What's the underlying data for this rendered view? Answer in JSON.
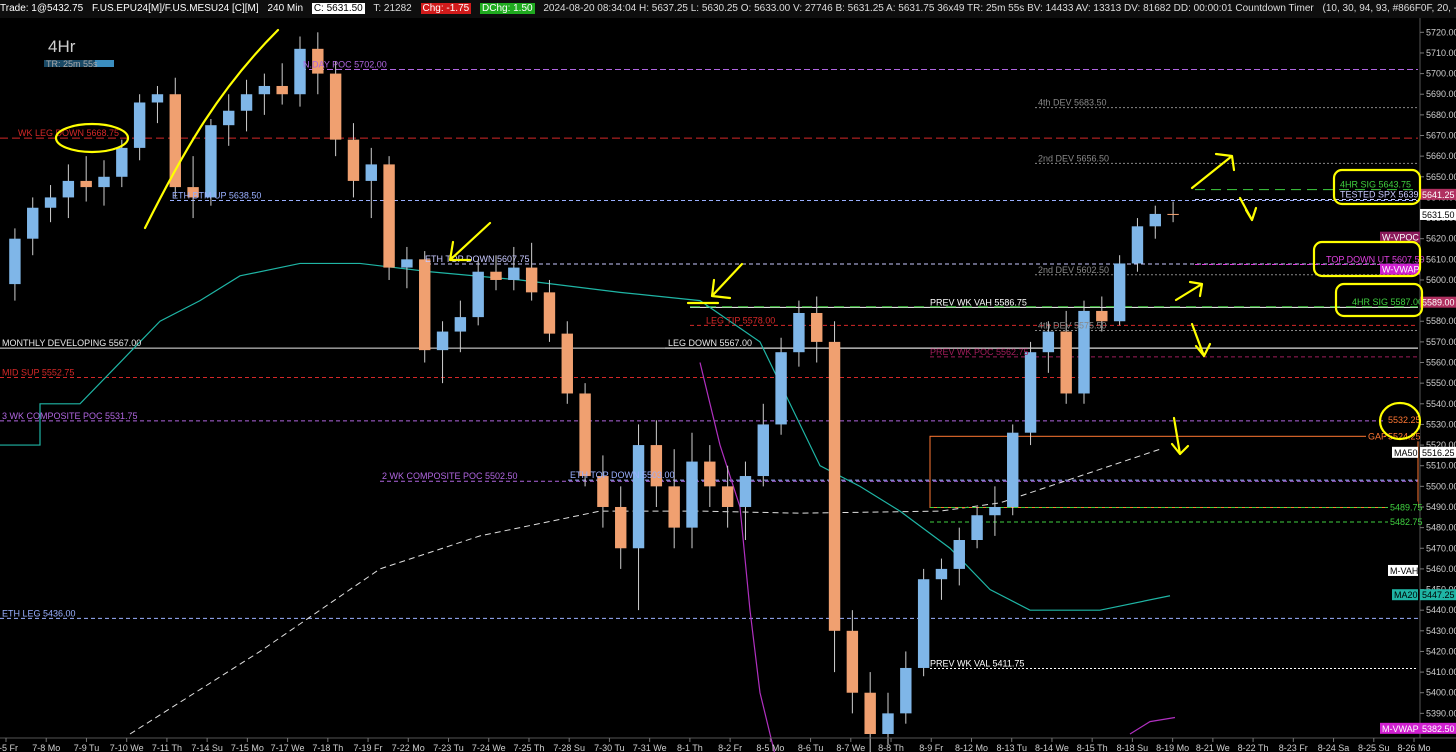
{
  "header": {
    "trade": "Trade: 1@5432.75",
    "symbol": "F.US.EPU24[M]/F.US.MESU24 [C][M]",
    "interval": "240 Min",
    "last": "C: 5631.50",
    "trades": "T: 21282",
    "chg": "Chg: -1.75",
    "dchg": "DChg: 1.50",
    "info": "2024-08-20 08:34:04 H: 5637.25 L: 5630.25 O: 5633.00 V: 27746 B: 5631.25 A: 5631.75 36x49 TR: 25m 55s BV: 14433 AV: 13313 DV: 81682 DD: 00:00:01 Countdown Timer",
    "params": "(10, 30, 94, 93, #866F0F, 20, -0.2, 1)"
  },
  "chart_title": "4Hr",
  "timer_label": "TR: 25m 55s",
  "chart_data": {
    "type": "candlestick",
    "y_range": [
      5380,
      5725
    ],
    "y_ticks": [
      5720,
      5710,
      5700,
      5690,
      5680,
      5670,
      5660,
      5650,
      5640,
      5630,
      5620,
      5610,
      5600,
      5590,
      5580,
      5570,
      5560,
      5550,
      5540,
      5530,
      5520,
      5510,
      5500,
      5490,
      5480,
      5470,
      5460,
      5450,
      5440,
      5430,
      5420,
      5410,
      5400,
      5390
    ],
    "x_labels": [
      "7-5 Fr",
      "7-8 Mo",
      "7-9 Tu",
      "7-10 We",
      "7-11 Th",
      "7-14 Su",
      "7-15 Mo",
      "7-17 We",
      "7-18 Th",
      "7-19 Fr",
      "7-22 Mo",
      "7-23 Tu",
      "7-24 We",
      "7-25 Th",
      "7-28 Su",
      "7-30 Tu",
      "7-31 We",
      "8-1 Th",
      "8-2 Fr",
      "8-5 Mo",
      "8-6 Tu",
      "8-7 We",
      "8-8 Th",
      "8-9 Fr",
      "8-12 Mo",
      "8-13 Tu",
      "8-14 We",
      "8-15 Th",
      "8-18 Su",
      "8-19 Mo",
      "8-21 We",
      "8-22 Th",
      "8-23 Fr",
      "8-24 Sa",
      "8-25 Su",
      "8-26 Mo"
    ],
    "candles": [
      [
        5598,
        5625,
        5590,
        5620
      ],
      [
        5620,
        5640,
        5612,
        5635
      ],
      [
        5635,
        5646,
        5628,
        5640
      ],
      [
        5640,
        5656,
        5630,
        5648
      ],
      [
        5648,
        5660,
        5638,
        5645
      ],
      [
        5645,
        5658,
        5636,
        5650
      ],
      [
        5650,
        5668,
        5645,
        5664
      ],
      [
        5664,
        5690,
        5658,
        5686
      ],
      [
        5686,
        5694,
        5676,
        5690
      ],
      [
        5690,
        5698,
        5640,
        5645
      ],
      [
        5645,
        5660,
        5630,
        5640
      ],
      [
        5640,
        5678,
        5636,
        5675
      ],
      [
        5675,
        5690,
        5665,
        5682
      ],
      [
        5682,
        5697,
        5672,
        5690
      ],
      [
        5690,
        5700,
        5680,
        5694
      ],
      [
        5694,
        5705,
        5685,
        5690
      ],
      [
        5690,
        5718,
        5684,
        5712
      ],
      [
        5712,
        5720,
        5690,
        5700
      ],
      [
        5700,
        5706,
        5660,
        5668
      ],
      [
        5668,
        5676,
        5640,
        5648
      ],
      [
        5648,
        5664,
        5630,
        5656
      ],
      [
        5656,
        5660,
        5600,
        5606
      ],
      [
        5606,
        5616,
        5596,
        5610
      ],
      [
        5610,
        5614,
        5560,
        5566
      ],
      [
        5566,
        5580,
        5550,
        5575
      ],
      [
        5575,
        5590,
        5565,
        5582
      ],
      [
        5582,
        5610,
        5578,
        5604
      ],
      [
        5604,
        5612,
        5595,
        5600
      ],
      [
        5600,
        5616,
        5595,
        5606
      ],
      [
        5606,
        5618,
        5590,
        5594
      ],
      [
        5594,
        5600,
        5570,
        5574
      ],
      [
        5574,
        5580,
        5540,
        5545
      ],
      [
        5545,
        5550,
        5500,
        5505
      ],
      [
        5505,
        5515,
        5480,
        5490
      ],
      [
        5490,
        5500,
        5460,
        5470
      ],
      [
        5470,
        5530,
        5440,
        5520
      ],
      [
        5520,
        5532,
        5490,
        5500
      ],
      [
        5500,
        5518,
        5470,
        5480
      ],
      [
        5480,
        5526,
        5470,
        5512
      ],
      [
        5512,
        5520,
        5490,
        5500
      ],
      [
        5500,
        5510,
        5480,
        5490
      ],
      [
        5490,
        5512,
        5474,
        5505
      ],
      [
        5505,
        5540,
        5500,
        5530
      ],
      [
        5530,
        5572,
        5525,
        5565
      ],
      [
        5565,
        5590,
        5558,
        5584
      ],
      [
        5584,
        5592,
        5560,
        5570
      ],
      [
        5570,
        5580,
        5410,
        5430
      ],
      [
        5430,
        5440,
        5390,
        5400
      ],
      [
        5400,
        5410,
        5370,
        5380
      ],
      [
        5380,
        5400,
        5375,
        5390
      ],
      [
        5390,
        5420,
        5385,
        5412
      ],
      [
        5412,
        5460,
        5408,
        5455
      ],
      [
        5455,
        5465,
        5445,
        5460
      ],
      [
        5460,
        5480,
        5452,
        5474
      ],
      [
        5474,
        5490,
        5470,
        5486
      ],
      [
        5486,
        5500,
        5476,
        5490
      ],
      [
        5490,
        5530,
        5486,
        5526
      ],
      [
        5526,
        5570,
        5520,
        5565
      ],
      [
        5565,
        5580,
        5555,
        5575
      ],
      [
        5575,
        5585,
        5540,
        5545
      ],
      [
        5545,
        5590,
        5540,
        5585
      ],
      [
        5585,
        5592,
        5575,
        5580
      ],
      [
        5580,
        5612,
        5578,
        5608
      ],
      [
        5608,
        5630,
        5604,
        5626
      ],
      [
        5626,
        5636,
        5620,
        5632
      ],
      [
        5632,
        5638,
        5628,
        5631.5
      ]
    ]
  },
  "levels": [
    {
      "label": "N.DAY POC  5702.00",
      "color": "#b066e0",
      "dash": "6,3"
    },
    {
      "label": "4th DEV  5683.50",
      "color": "#888888",
      "dash": "2,2"
    },
    {
      "label": "WK LEG DOWN  5668.75",
      "color": "#d42828",
      "dash": "8,4"
    },
    {
      "label": "2nd DEV  5656.50",
      "color": "#888888",
      "dash": "2,2"
    },
    {
      "label": "4HR SIG  5643.75",
      "color": "#3fcf3f",
      "dash": "10,6"
    },
    {
      "label": "TESTED SPX  5639.00",
      "color": "#c8c8ff",
      "dash": "4,3"
    },
    {
      "label": "ETH BTM UP  5638.50",
      "color": "#9ab0ff",
      "dash": "4,3"
    },
    {
      "label": "ETH TOP DOWN  5607.75",
      "color": "#c8c8ff",
      "dash": "4,3"
    },
    {
      "label": "2nd DEV  5602.50",
      "color": "#888888",
      "dash": "2,2"
    },
    {
      "label": "TOP DOWN UT  5607.50",
      "color": "#e040e0",
      "dash": "4,3"
    },
    {
      "label": "PREV WK VAH  5586.75",
      "color": "#ffffff",
      "dash": ""
    },
    {
      "label": "4HR SIG  5587.00",
      "color": "#3fcf3f",
      "dash": "10,6"
    },
    {
      "label": "LEG TIP  5578.00",
      "color": "#d42828",
      "dash": "4,3"
    },
    {
      "label": "4th DEV  5575.50",
      "color": "#888888",
      "dash": "2,2"
    },
    {
      "label": "MONTHLY DEVELOPING  5567.00",
      "color": "#e8e8e8",
      "dash": ""
    },
    {
      "label": "LEG DOWN  5567.00",
      "color": "#e8e8e8",
      "dash": ""
    },
    {
      "label": "PREV WK POC  5562.75",
      "color": "#a01c5a",
      "dash": "4,3"
    },
    {
      "label": "MID SUP  5552.75",
      "color": "#d42828",
      "dash": "4,3"
    },
    {
      "label": "3 WK COMPOSITE POC  5531.75",
      "color": "#b066e0",
      "dash": "4,3"
    },
    {
      "label": "2 WK COMPOSITE POC  5502.50",
      "color": "#b066e0",
      "dash": "4,3"
    },
    {
      "label": "ETH TOP DOWN  5503.00",
      "color": "#9ab0ff",
      "dash": "4,3"
    },
    {
      "label": "ETH LEG  5436.00",
      "color": "#9ab0ff",
      "dash": "4,3"
    },
    {
      "label": "PREV WK VAL  5411.75",
      "color": "#ffffff",
      "dash": "2,2"
    }
  ],
  "price_tags": [
    {
      "label": "5641.25",
      "bg": "#b03060",
      "fg": "#ffffff"
    },
    {
      "label": "5631.50",
      "bg": "#ffffff",
      "fg": "#000000"
    },
    {
      "label": "W-VPOC",
      "bg": "#8a1a5a",
      "fg": "#ffffff"
    },
    {
      "label": "W-VWAP",
      "bg": "#d020d0",
      "fg": "#ffffff"
    },
    {
      "label": "5589.00",
      "bg": "#b03060",
      "fg": "#ffffff"
    },
    {
      "label": "5532.25",
      "bg": "#000000",
      "fg": "#ff7733"
    },
    {
      "label": "5524.25",
      "bg": "#000000",
      "fg": "#ff7733"
    },
    {
      "label": "GAP",
      "bg": "#000000",
      "fg": "#ff7733"
    },
    {
      "label": "MA50",
      "bg": "#ffffff",
      "fg": "#000000"
    },
    {
      "label": "5516.25",
      "bg": "#ffffff",
      "fg": "#000000"
    },
    {
      "label": "5489.75",
      "bg": "#000000",
      "fg": "#3fcf3f"
    },
    {
      "label": "5482.75",
      "bg": "#000000",
      "fg": "#3fcf3f"
    },
    {
      "label": "M-VAH",
      "bg": "#ffffff",
      "fg": "#000000"
    },
    {
      "label": "MA20",
      "bg": "#1fb5a5",
      "fg": "#000000"
    },
    {
      "label": "5447.25",
      "bg": "#1fb5a5",
      "fg": "#000000"
    },
    {
      "label": "M-VWAP",
      "bg": "#d020d0",
      "fg": "#ffffff"
    },
    {
      "label": "5382.50",
      "bg": "#d020d0",
      "fg": "#ffffff"
    }
  ],
  "colors": {
    "up": "#7fb6e8",
    "down": "#f0a070",
    "ma20": "#1fb5a5",
    "mvwap": "#b030c0",
    "annotation": "#ffff00"
  }
}
